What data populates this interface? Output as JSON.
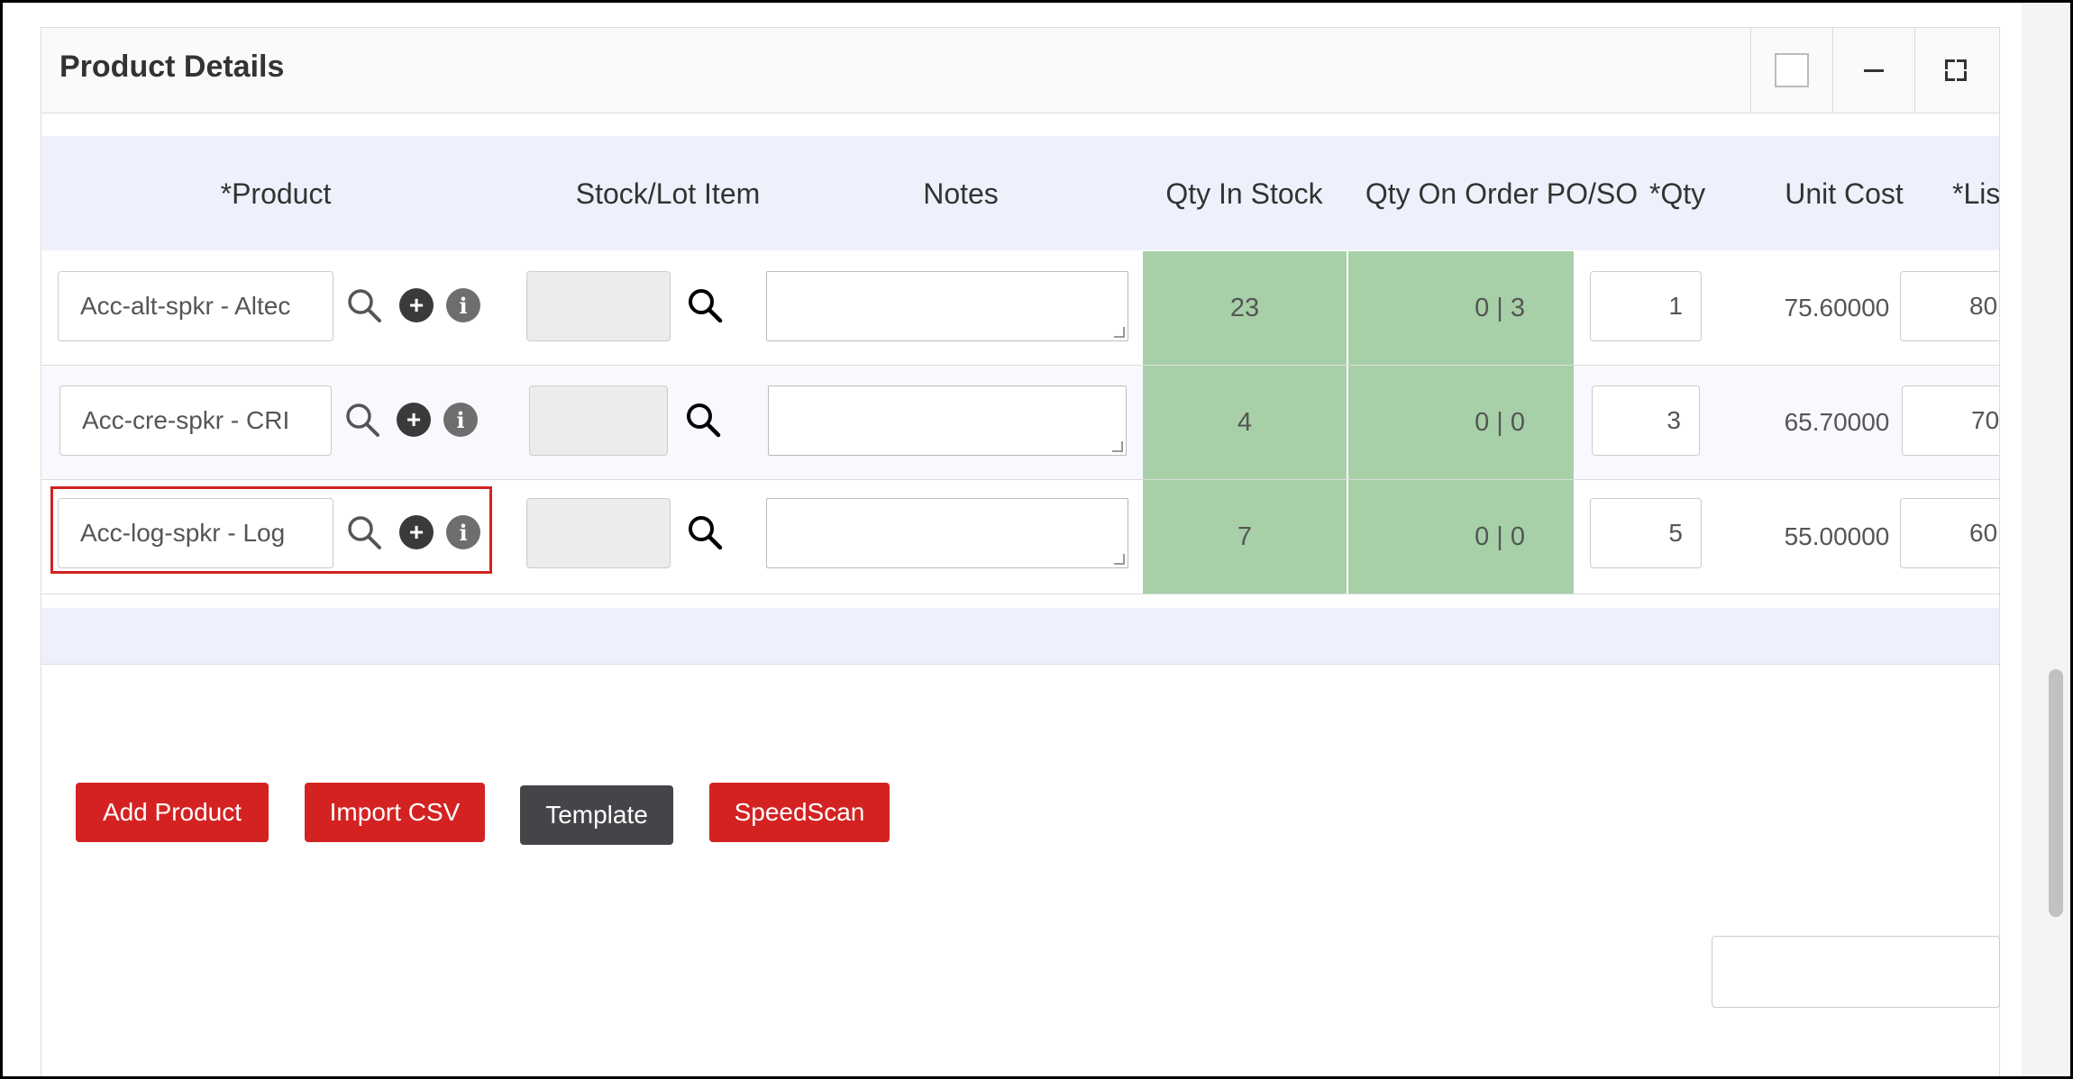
{
  "panel": {
    "title": "Product Details"
  },
  "table": {
    "headers": {
      "product": "*Product",
      "stock_lot": "Stock/Lot Item",
      "notes": "Notes",
      "qty_in_stock": "Qty In Stock",
      "qty_on_order": "Qty On Order PO/SO",
      "qty": "*Qty",
      "unit_cost": "Unit Cost",
      "list": "*List"
    },
    "rows": [
      {
        "product": "Acc-alt-spkr - Altec",
        "qty_in_stock": "23",
        "qty_on_order": "0 | 3",
        "qty": "1",
        "unit_cost": "75.60000",
        "list": "80"
      },
      {
        "product": "Acc-cre-spkr - CRI",
        "qty_in_stock": "4",
        "qty_on_order": "0 | 0",
        "qty": "3",
        "unit_cost": "65.70000",
        "list": "70"
      },
      {
        "product": "Acc-log-spkr - Log",
        "qty_in_stock": "7",
        "qty_on_order": "0 | 0",
        "qty": "5",
        "unit_cost": "55.00000",
        "list": "60"
      }
    ]
  },
  "buttons": {
    "add_product": "Add Product",
    "import_csv": "Import CSV",
    "template": "Template",
    "speedscan": "SpeedScan"
  },
  "colors": {
    "accent_red": "#d42222",
    "dark_button": "#454549",
    "stock_green": "#a8d0a8",
    "header_band": "#eef1fc"
  },
  "icons": [
    "search-icon",
    "plus-circle-icon",
    "info-circle-icon",
    "checkbox-icon",
    "minimize-icon",
    "fullscreen-icon"
  ]
}
